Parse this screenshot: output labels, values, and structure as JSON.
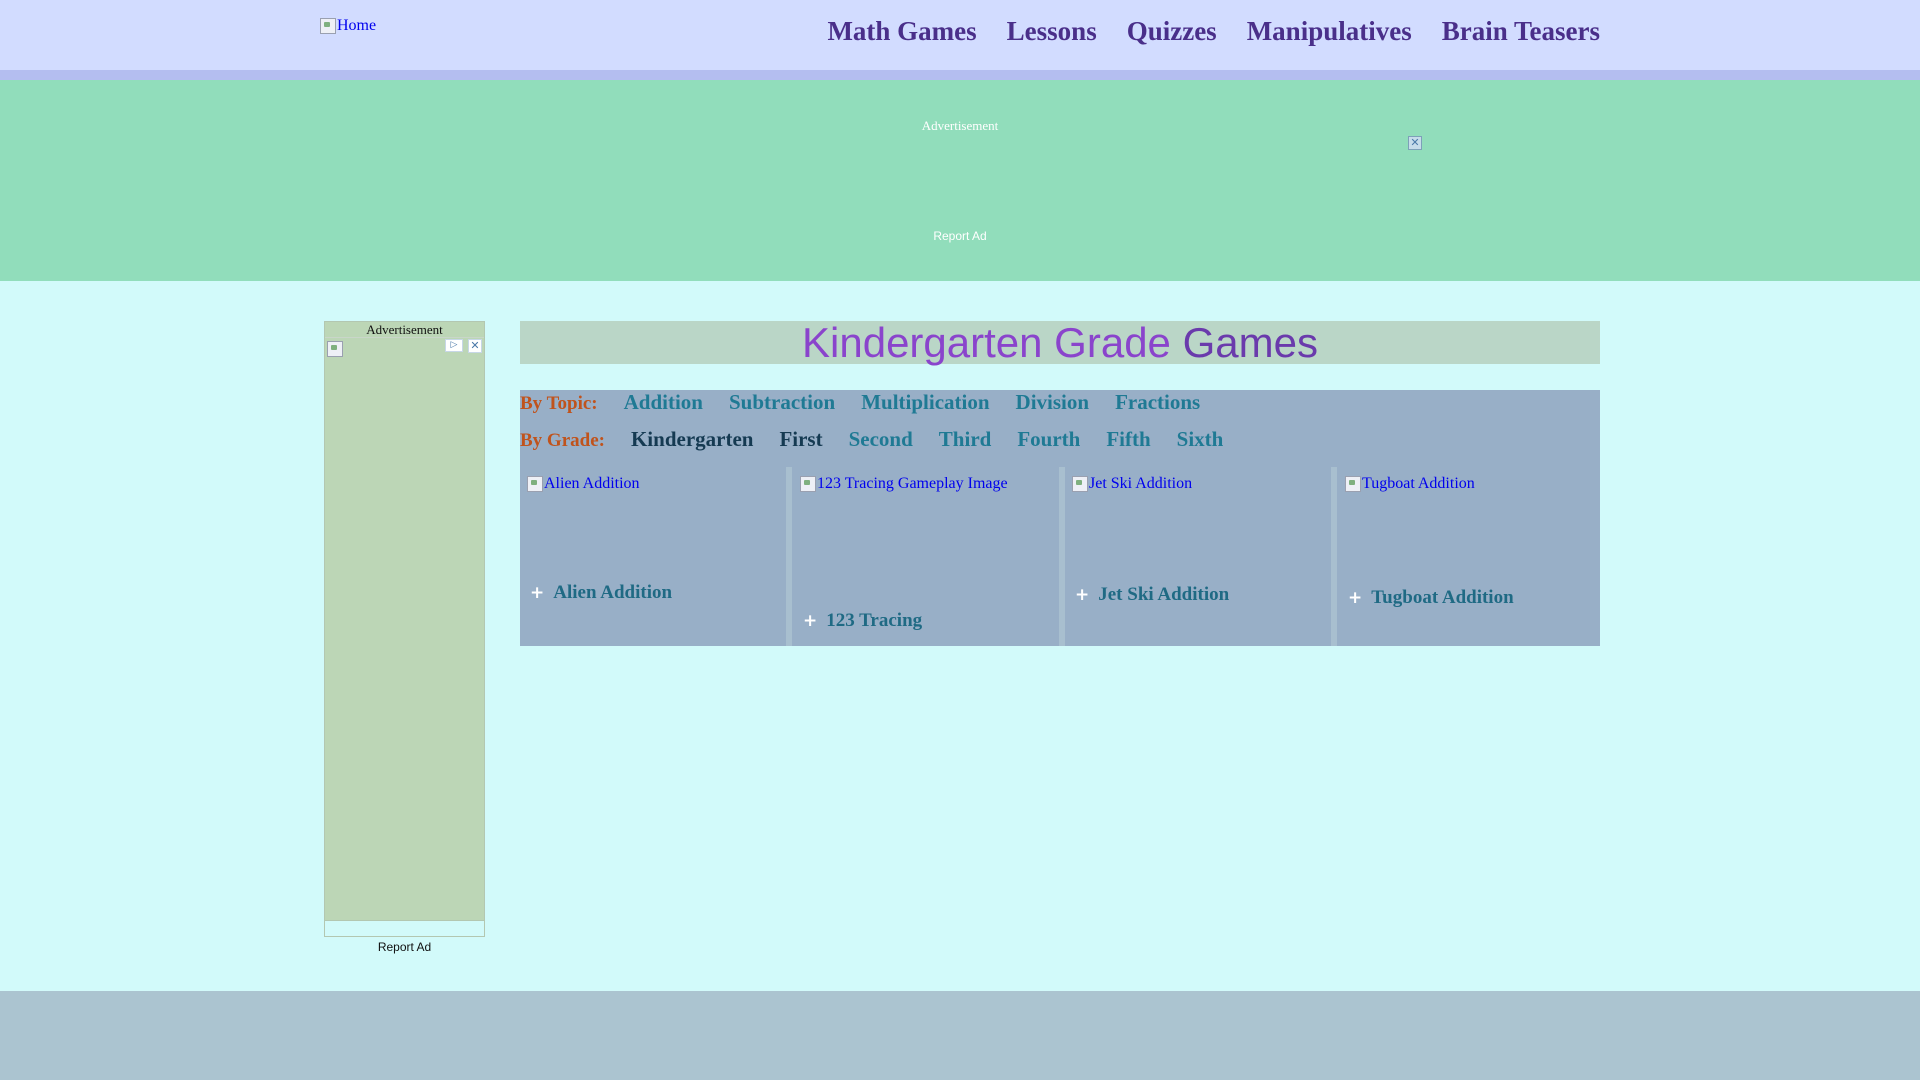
{
  "header": {
    "home_alt": "Home",
    "nav": [
      "Math Games",
      "Lessons",
      "Quizzes",
      "Manipulatives",
      "Brain Teasers"
    ]
  },
  "top_ad": {
    "label": "Advertisement",
    "close": "✕",
    "report": "Report Ad"
  },
  "side_ad": {
    "label": "Advertisement",
    "choices_icon": "adchoices-icon",
    "close": "✕",
    "report": "Report Ad"
  },
  "main": {
    "title_part1": "Kindergarten Grade",
    "title_part2": "Games",
    "by_topic_label": "By Topic:",
    "topics": [
      "Addition",
      "Subtraction",
      "Multiplication",
      "Division",
      "Fractions"
    ],
    "by_grade_label": "By Grade:",
    "grades": [
      "Kindergarten",
      "First",
      "Second",
      "Third",
      "Fourth",
      "Fifth",
      "Sixth"
    ],
    "current_grade": "Kindergarten",
    "games": [
      {
        "img_alt": "Alien Addition",
        "name": "Alien Addition"
      },
      {
        "img_alt": "123 Tracing Gameplay Image",
        "name": "123 Tracing"
      },
      {
        "img_alt": "Jet Ski Addition",
        "name": "Jet Ski Addition"
      },
      {
        "img_alt": "Tugboat Addition",
        "name": "Tugboat Addition"
      }
    ]
  },
  "colors": {
    "header_bg": "#d2dcff",
    "ad_band_bg": "#91ddbb",
    "page_bg": "#d2fafa",
    "title_color": "#8a44cc",
    "filter_bg": "#98afc7",
    "label_orange": "#c0531c",
    "link_teal": "#1f7a94",
    "nav_purple": "#4a2f8a",
    "footer_bg": "#abc4d0"
  }
}
